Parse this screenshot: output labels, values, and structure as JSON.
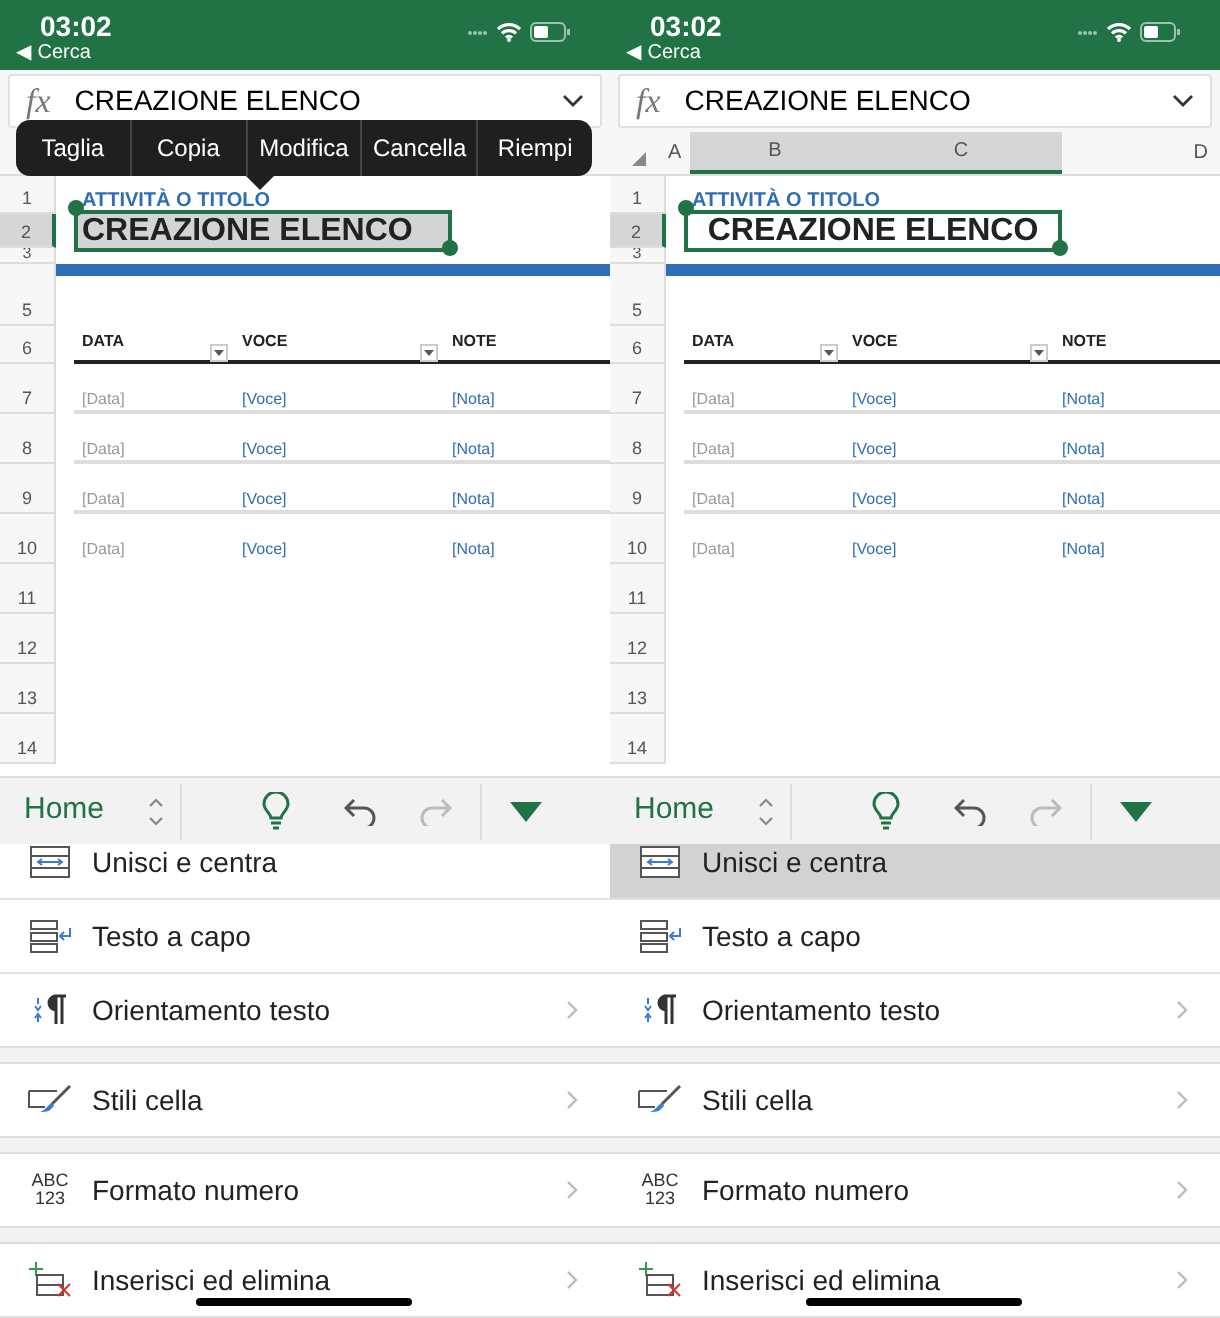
{
  "phones": [
    {
      "status_bar": {
        "time": "03:02",
        "back": "◀ Cerca"
      },
      "formula_bar": {
        "label": "fx",
        "value": "CREAZIONE ELENCO"
      },
      "context_menu": {
        "items": [
          "Taglia",
          "Copia",
          "Modifica",
          "Cancella",
          "Riempi"
        ]
      },
      "sheet": {
        "rows": [
          {
            "number": "1",
            "selected": false,
            "kind": "subtitle",
            "text": "ATTIVITÀ O TITOLO"
          },
          {
            "number": "2",
            "selected": true,
            "kind": "title",
            "text": "CREAZIONE ELENCO",
            "merged": false
          },
          {
            "number": "3",
            "selected": false,
            "kind": "rule"
          },
          {
            "number": "5",
            "selected": false,
            "kind": "blank"
          },
          {
            "number": "6",
            "selected": false,
            "kind": "header",
            "cells": [
              "DATA",
              "VOCE",
              "NOTE"
            ]
          },
          {
            "number": "7",
            "selected": false,
            "kind": "item",
            "cells": [
              "[Data]",
              "[Voce]",
              "[Nota]"
            ]
          },
          {
            "number": "8",
            "selected": false,
            "kind": "item",
            "cells": [
              "[Data]",
              "[Voce]",
              "[Nota]"
            ]
          },
          {
            "number": "9",
            "selected": false,
            "kind": "item",
            "cells": [
              "[Data]",
              "[Voce]",
              "[Nota]"
            ]
          },
          {
            "number": "10",
            "selected": false,
            "kind": "item",
            "cells": [
              "[Data]",
              "[Voce]",
              "[Nota]"
            ]
          },
          {
            "number": "11",
            "selected": false,
            "kind": "blank"
          },
          {
            "number": "12",
            "selected": false,
            "kind": "blank"
          },
          {
            "number": "13",
            "selected": false,
            "kind": "blank"
          },
          {
            "number": "14",
            "selected": false,
            "kind": "blank"
          }
        ]
      },
      "toolbar": {
        "tab": "Home"
      },
      "menu": {
        "groups": [
          [
            {
              "kind": "merge",
              "label": "Unisci e centra",
              "chevron": false,
              "selected": false
            },
            {
              "kind": "wrap",
              "label": "Testo a capo",
              "chevron": false,
              "selected": false
            },
            {
              "kind": "orientation",
              "label": "Orientamento testo",
              "chevron": true,
              "selected": false
            }
          ],
          [
            {
              "kind": "styles",
              "label": "Stili cella",
              "chevron": true,
              "selected": false
            }
          ],
          [
            {
              "kind": "number-format",
              "icon_text": [
                "ABC",
                "123"
              ],
              "label": "Formato numero",
              "chevron": true,
              "selected": false
            }
          ],
          [
            {
              "kind": "insert-delete",
              "label": "Inserisci ed elimina",
              "chevron": true,
              "selected": false
            }
          ]
        ]
      }
    },
    {
      "status_bar": {
        "time": "03:02",
        "back": "◀ Cerca"
      },
      "formula_bar": {
        "label": "fx",
        "value": "CREAZIONE ELENCO"
      },
      "column_headers": [
        {
          "label": "A",
          "selected": false
        },
        {
          "label": "B",
          "selected": true
        },
        {
          "label": "C",
          "selected": true
        },
        {
          "label": "D",
          "selected": false
        }
      ],
      "sheet": {
        "rows": [
          {
            "number": "1",
            "selected": false,
            "kind": "subtitle",
            "text": "ATTIVITÀ O TITOLO"
          },
          {
            "number": "2",
            "selected": true,
            "kind": "title",
            "text": "CREAZIONE ELENCO",
            "merged": true
          },
          {
            "number": "3",
            "selected": false,
            "kind": "rule"
          },
          {
            "number": "5",
            "selected": false,
            "kind": "blank"
          },
          {
            "number": "6",
            "selected": false,
            "kind": "header",
            "cells": [
              "DATA",
              "VOCE",
              "NOTE"
            ]
          },
          {
            "number": "7",
            "selected": false,
            "kind": "item",
            "cells": [
              "[Data]",
              "[Voce]",
              "[Nota]"
            ]
          },
          {
            "number": "8",
            "selected": false,
            "kind": "item",
            "cells": [
              "[Data]",
              "[Voce]",
              "[Nota]"
            ]
          },
          {
            "number": "9",
            "selected": false,
            "kind": "item",
            "cells": [
              "[Data]",
              "[Voce]",
              "[Nota]"
            ]
          },
          {
            "number": "10",
            "selected": false,
            "kind": "item",
            "cells": [
              "[Data]",
              "[Voce]",
              "[Nota]"
            ]
          },
          {
            "number": "11",
            "selected": false,
            "kind": "blank"
          },
          {
            "number": "12",
            "selected": false,
            "kind": "blank"
          },
          {
            "number": "13",
            "selected": false,
            "kind": "blank"
          },
          {
            "number": "14",
            "selected": false,
            "kind": "blank"
          }
        ]
      },
      "toolbar": {
        "tab": "Home"
      },
      "menu": {
        "groups": [
          [
            {
              "kind": "merge",
              "label": "Unisci e centra",
              "chevron": false,
              "selected": true
            },
            {
              "kind": "wrap",
              "label": "Testo a capo",
              "chevron": false,
              "selected": false
            },
            {
              "kind": "orientation",
              "label": "Orientamento testo",
              "chevron": true,
              "selected": false
            }
          ],
          [
            {
              "kind": "styles",
              "label": "Stili cella",
              "chevron": true,
              "selected": false
            }
          ],
          [
            {
              "kind": "number-format",
              "icon_text": [
                "ABC",
                "123"
              ],
              "label": "Formato numero",
              "chevron": true,
              "selected": false
            }
          ],
          [
            {
              "kind": "insert-delete",
              "label": "Inserisci ed elimina",
              "chevron": true,
              "selected": false
            }
          ]
        ]
      }
    }
  ]
}
